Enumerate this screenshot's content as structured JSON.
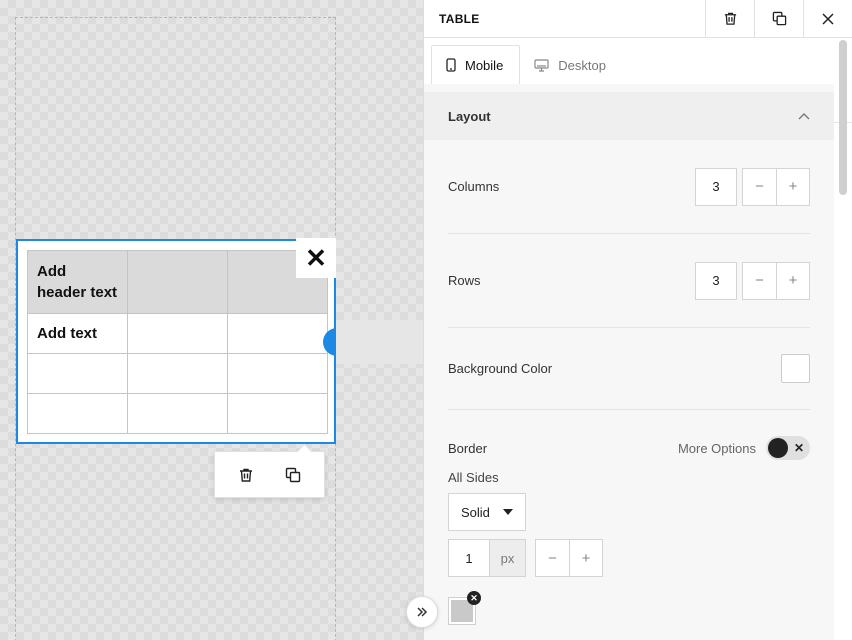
{
  "panel": {
    "title": "TABLE",
    "tabs": [
      {
        "label": "Mobile",
        "icon": "mobile-icon",
        "active": true
      },
      {
        "label": "Desktop",
        "icon": "desktop-icon",
        "active": false
      }
    ],
    "layout": {
      "title": "Layout",
      "columns": {
        "label": "Columns",
        "value": "3"
      },
      "rows": {
        "label": "Rows",
        "value": "3"
      },
      "background_color": {
        "label": "Background Color",
        "value": "#ffffff"
      },
      "border": {
        "label": "Border",
        "more_options": "More Options",
        "all_sides": "All Sides",
        "style": "Solid",
        "width": "1",
        "unit": "px",
        "color": "#c9c9c9"
      }
    },
    "stepper": {
      "minus": "−",
      "plus": "+"
    }
  },
  "canvas": {
    "table": {
      "rows": [
        [
          "Add header text",
          "",
          ""
        ],
        [
          "Add text",
          "",
          ""
        ],
        [
          "",
          "",
          ""
        ],
        [
          "",
          "",
          ""
        ]
      ]
    },
    "close_glyph": "✕"
  },
  "colors": {
    "accent": "#1e88e5",
    "header_fill": "#dadada"
  }
}
